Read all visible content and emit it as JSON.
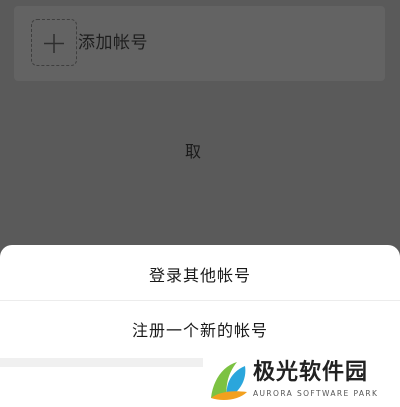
{
  "add_account": {
    "label": "添加帐号"
  },
  "sheet": {
    "items": [
      {
        "label": "登录其他帐号"
      },
      {
        "label": "注册一个新的帐号"
      }
    ],
    "cancel_label": "取"
  },
  "watermark": {
    "title": "极光软件园",
    "subtitle": "AURORA SOFTWARE PARK"
  },
  "colors": {
    "overlay": "#5a5a5a",
    "sheet_bg": "#ffffff",
    "logo_green": "#7cc242",
    "logo_blue": "#2aa6dc",
    "logo_orange": "#f2a01e"
  }
}
